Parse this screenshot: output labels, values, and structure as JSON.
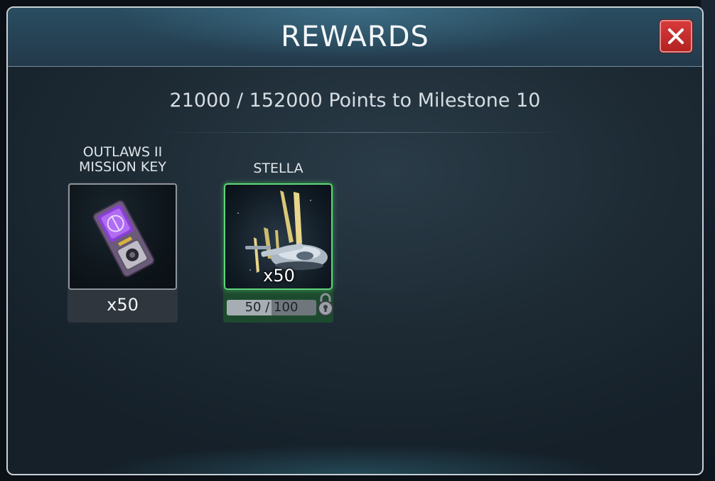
{
  "dialog": {
    "title": "REWARDS",
    "subtitle": "21000 / 152000 Points to Milestone 10"
  },
  "rewards": [
    {
      "title_line1": "OUTLAWS II",
      "title_line2": "MISSION KEY",
      "icon": "mission-key-icon",
      "quantity": "x50"
    },
    {
      "title": "STELLA",
      "icon": "stella-ship-icon",
      "quantity": "x50",
      "progress_text_current": "50",
      "progress_text_sep": "/",
      "progress_text_total": "100",
      "progress_fraction": 0.5,
      "locked": true
    }
  ],
  "colors": {
    "accent_green": "#5ed47a",
    "close_red": "#d83a3a",
    "purple": "#8b3fd6"
  }
}
